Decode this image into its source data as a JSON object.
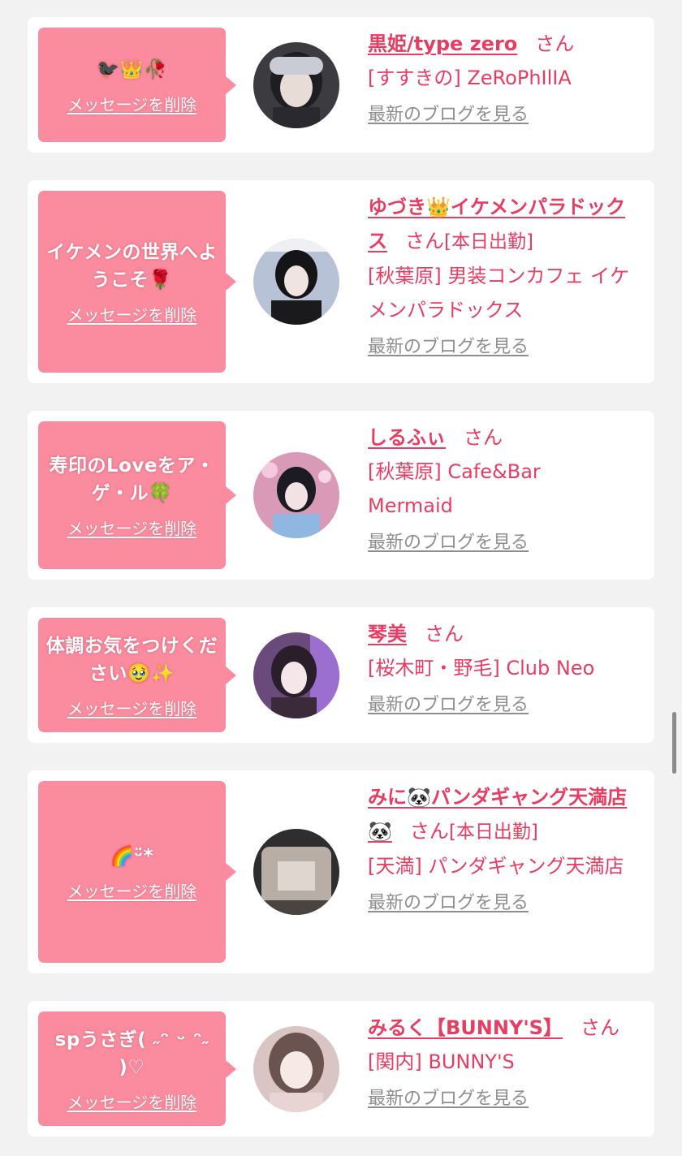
{
  "cards": [
    {
      "message": "🐦‍⬛👑🥀",
      "delete_label": "メッセージを削除",
      "name": "黒姫/type zero",
      "honorific": "さん",
      "shift": "",
      "shop": "[すすきの] ZeRoPhIlIA",
      "blog_link": "最新のブログを見る",
      "avatar_icon": "avatar-photo"
    },
    {
      "message": "イケメンの世界へようこそ🌹",
      "delete_label": "メッセージを削除",
      "name": "ゆづき👑イケメンパラドックス",
      "honorific": "さん",
      "shift": "[本日出勤]",
      "shop": "[秋葉原] 男装コンカフェ イケメンパラドックス",
      "blog_link": "最新のブログを見る",
      "avatar_icon": "avatar-photo"
    },
    {
      "message": "寿印のLoveをア・ゲ・ル🍀",
      "delete_label": "メッセージを削除",
      "name": "しるふぃ",
      "honorific": "さん",
      "shift": "",
      "shop": "[秋葉原] Cafe&Bar Mermaid",
      "blog_link": "最新のブログを見る",
      "avatar_icon": "avatar-photo"
    },
    {
      "message": "体調お気をつけください🥹✨",
      "delete_label": "メッセージを削除",
      "name": "琴美",
      "honorific": "さん",
      "shift": "",
      "shop": "[桜木町・野毛] Club Neo",
      "blog_link": "最新のブログを見る",
      "avatar_icon": "avatar-photo"
    },
    {
      "message": "🌈ᵕ̈*",
      "delete_label": "メッセージを削除",
      "name": "みに🐼パンダギャング天満店🐼",
      "honorific": "さん",
      "shift": "[本日出勤]",
      "shop": "[天満] パンダギャング天満店",
      "blog_link": "最新のブログを見る",
      "avatar_icon": "avatar-photo"
    },
    {
      "message": "spうさぎ( ˶ᵔ ᵕ ᵔ˶ )♡",
      "delete_label": "メッセージを削除",
      "name": "みるく【BUNNY'S】",
      "honorific": "さん",
      "shift": "",
      "shop": "[関内] BUNNY'S",
      "blog_link": "最新のブログを見る",
      "avatar_icon": "avatar-photo"
    }
  ],
  "colors": {
    "accent": "#e83d63",
    "bubble": "#fb8c9f",
    "link_gray": "#8e8e8e",
    "background": "#f2f2f2"
  }
}
